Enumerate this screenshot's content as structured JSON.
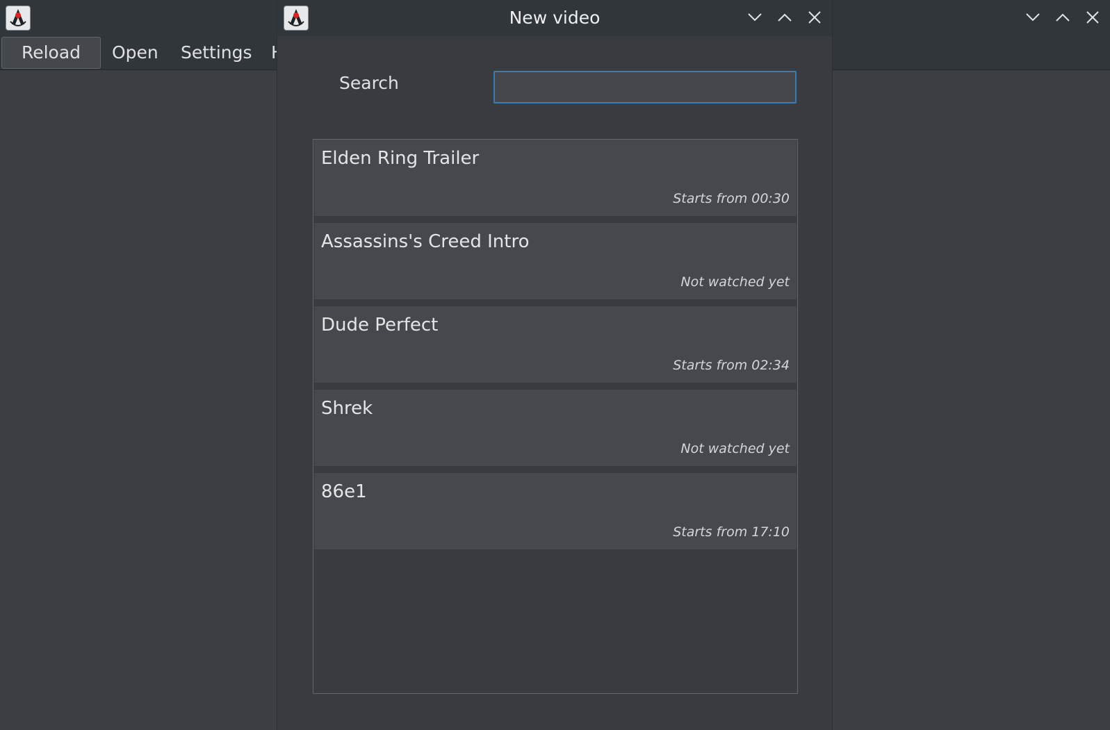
{
  "main_window": {
    "menu": {
      "reload": "Reload",
      "open": "Open",
      "settings": "Settings",
      "help_partial": "H"
    }
  },
  "dialog": {
    "title": "New video",
    "search": {
      "label": "Search",
      "value": "",
      "placeholder": ""
    },
    "videos": [
      {
        "title": "Elden Ring Trailer",
        "status": "Starts from 00:30"
      },
      {
        "title": "Assassins's Creed Intro",
        "status": "Not watched yet"
      },
      {
        "title": "Dude Perfect",
        "status": "Starts from 02:34"
      },
      {
        "title": "Shrek",
        "status": "Not watched yet"
      },
      {
        "title": "86e1",
        "status": "Starts from 17:10"
      }
    ]
  },
  "icons": {
    "app": "java-duke-icon",
    "minimize": "chevron-down-icon",
    "maximize": "chevron-up-icon",
    "close": "close-icon"
  },
  "colors": {
    "background": "#3b3e42",
    "titlebar": "#31363b",
    "list_item": "#45494d",
    "focus_border": "#3d7ab0",
    "text": "#dfe1e3"
  }
}
